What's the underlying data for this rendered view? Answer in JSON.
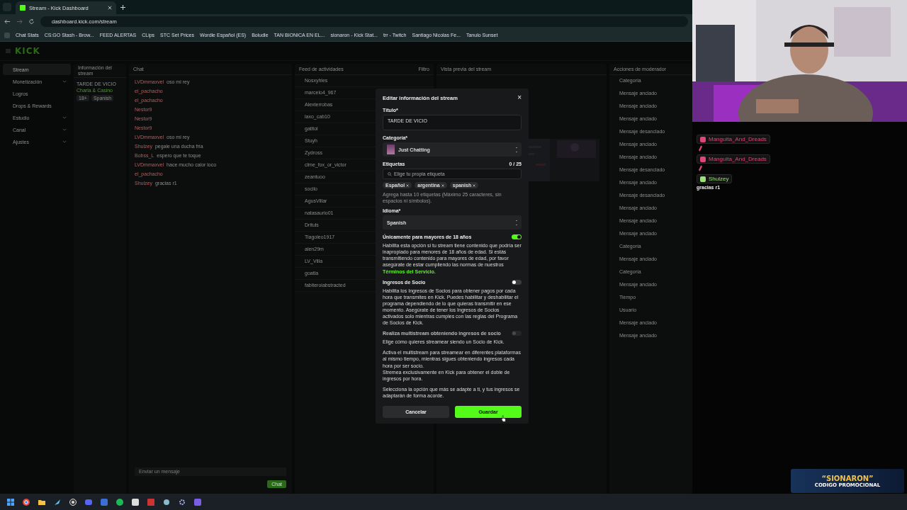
{
  "browser": {
    "tab_title": "Stream - Kick Dashboard",
    "url": "dashboard.kick.com/stream",
    "bookmarks": [
      "Chat Stats",
      "CS:GO Stash - Brow...",
      "FEED ALERTAS",
      "CLips",
      "STC Set Prices",
      "Wordle Español (ES)",
      "Boludle",
      "TAN BIONICA EN EL...",
      "sionaron - Kick Stat...",
      "trr - Twitch",
      "Santiago Nicolas Fe...",
      "Tanulo Sunset"
    ]
  },
  "sidebar": {
    "logo": "KICK",
    "items": [
      {
        "label": "Stream",
        "selected": true,
        "expandable": false
      },
      {
        "label": "Monetización",
        "selected": false,
        "expandable": true
      },
      {
        "label": "Logros",
        "selected": false,
        "expandable": false
      },
      {
        "label": "Drops & Rewards",
        "selected": false,
        "expandable": false
      },
      {
        "label": "Estudio",
        "selected": false,
        "expandable": true
      },
      {
        "label": "Canal",
        "selected": false,
        "expandable": true
      },
      {
        "label": "Ajustes",
        "selected": false,
        "expandable": true
      }
    ]
  },
  "info_panel": {
    "title": "Información del stream",
    "stream_title": "TARDE DE VICIO",
    "category": "Charla & Casino",
    "tags": [
      "18+",
      "Spanish"
    ]
  },
  "chat_panel": {
    "title": "Chat",
    "messages": [
      {
        "user": "LVDmmaxvel",
        "text": "oso mi rey"
      },
      {
        "user": "el_pachacho"
      },
      {
        "user": "el_pachacho"
      },
      {
        "user": "Nestor9"
      },
      {
        "user": "Nestor9"
      },
      {
        "user": "Nestor9"
      },
      {
        "user": "LVDmmaxvel",
        "text": "oso mi rey"
      },
      {
        "user": "Shulzey",
        "text": "pegale una ducha fría"
      },
      {
        "user": "Bobss_L",
        "text": "espero que te toque"
      },
      {
        "user": "LVDmmaxvel",
        "text": "hace mucho calor loco"
      },
      {
        "user": "el_pachacho"
      },
      {
        "user": "Shulzey",
        "text": "gracias r1"
      }
    ],
    "input_placeholder": "Enviar un mensaje",
    "send_label": "Chat"
  },
  "feed_panel": {
    "title": "Feed de actividades",
    "filter": "Filtro",
    "items": [
      "Nosxyhles",
      "marcelo4_967",
      "Alexterrobas",
      "laxo_cab10",
      "gatitol",
      "Stuyh",
      "Zydross",
      "clme_fox_or_victor",
      "zeantuoo",
      "socilo",
      "AgusVillar",
      "natasaurio01",
      "Drituls",
      "Tiagoleo1917",
      "alen29m",
      "LV_Villa",
      "goatla",
      "fabiteroiabstracted"
    ]
  },
  "preview_panel": {
    "title": "Vista previa del stream"
  },
  "moderator_panel": {
    "title": "Acciones de moderador",
    "items": [
      "Categoría",
      "Mensaje anclado",
      "Mensaje anclado",
      "Mensaje anclado",
      "Mensaje desanclado",
      "Mensaje anclado",
      "Mensaje anclado",
      "Mensaje desanclado",
      "Mensaje anclado",
      "Mensaje desanclado",
      "Mensaje anclado",
      "Mensaje anclado",
      "Mensaje anclado",
      "Categoría",
      "Mensaje anclado",
      "Categoría",
      "Mensaje anclado",
      "Tiempo",
      "Usuario",
      "Mensaje anclado",
      "Mensaje anclado"
    ]
  },
  "modal": {
    "title": "Editar información del stream",
    "close": "×",
    "title_label": "Título*",
    "title_value": "TARDE DE VICIO",
    "category_label": "Categoría*",
    "category": "Just Chatting",
    "tags_label": "Etiquetas",
    "tags_count": "0 / 25",
    "tags_placeholder": "Elige tu propia etiqueta",
    "tags": [
      "Español",
      "argentina",
      "spanish"
    ],
    "tags_hint": "Agrega hasta 10 etiquetas (Máximo 25 caracteres, sin espacios ni símbolos).",
    "language_label": "Idioma*",
    "language": "Spanish",
    "toggles": [
      {
        "label": "Únicamente para mayores de 18 años",
        "on": true,
        "disabled": false,
        "description": "Habilita esta opción si tu stream tiene contenido que podría ser inapropiado para menores de 18 años de edad. Si estás transmitiendo contenido para mayores de edad, por favor asegúrate de estar cumpliendo las normas de nuestros ",
        "link": "Términos del Servicio."
      },
      {
        "label": "Ingresos de Socio",
        "on": false,
        "disabled": false,
        "description": "Habilita los Ingresos de Socios para obtener pagos por cada hora que transmites en Kick. Puedes habilitar y deshabilitar el programa dependiendo de lo que quieras transmitir en ese momento. Asegúrate de tener los Ingresos de Socios activados solo mientras cumples con las reglas del Programa de Socios de Kick."
      },
      {
        "label": "Realiza multistream obteniendo ingresos de socio",
        "on": false,
        "disabled": true,
        "description": "Elige cómo quieres streamear siendo un Socio de Kick."
      }
    ],
    "notes": [
      "Activa el multistream para streamear en diferentes plataformas al mismo tiempo, mientras sigues obteniendo ingresos cada hora por ser socio.\nStremea exclusivamente en Kick para obtener el doble de ingresos por hora.",
      "Selecciona la opción que más se adapte a ti, y tus ingresos se adaptarán de forma acorde."
    ],
    "cancel": "Cancelar",
    "save": "Guardar"
  },
  "chat_overlay": [
    {
      "user": "Manguita_And_Dreads",
      "color": "#e0457b"
    },
    {
      "user": "Manguita_And_Dreads",
      "color": "#e0457b"
    },
    {
      "user": "Shulzey",
      "color": "#9be07a",
      "message": "gracias r1"
    }
  ],
  "promo": {
    "title": "“SIONARON”",
    "subtitle": "CODIGO PROMOCIONAL"
  }
}
